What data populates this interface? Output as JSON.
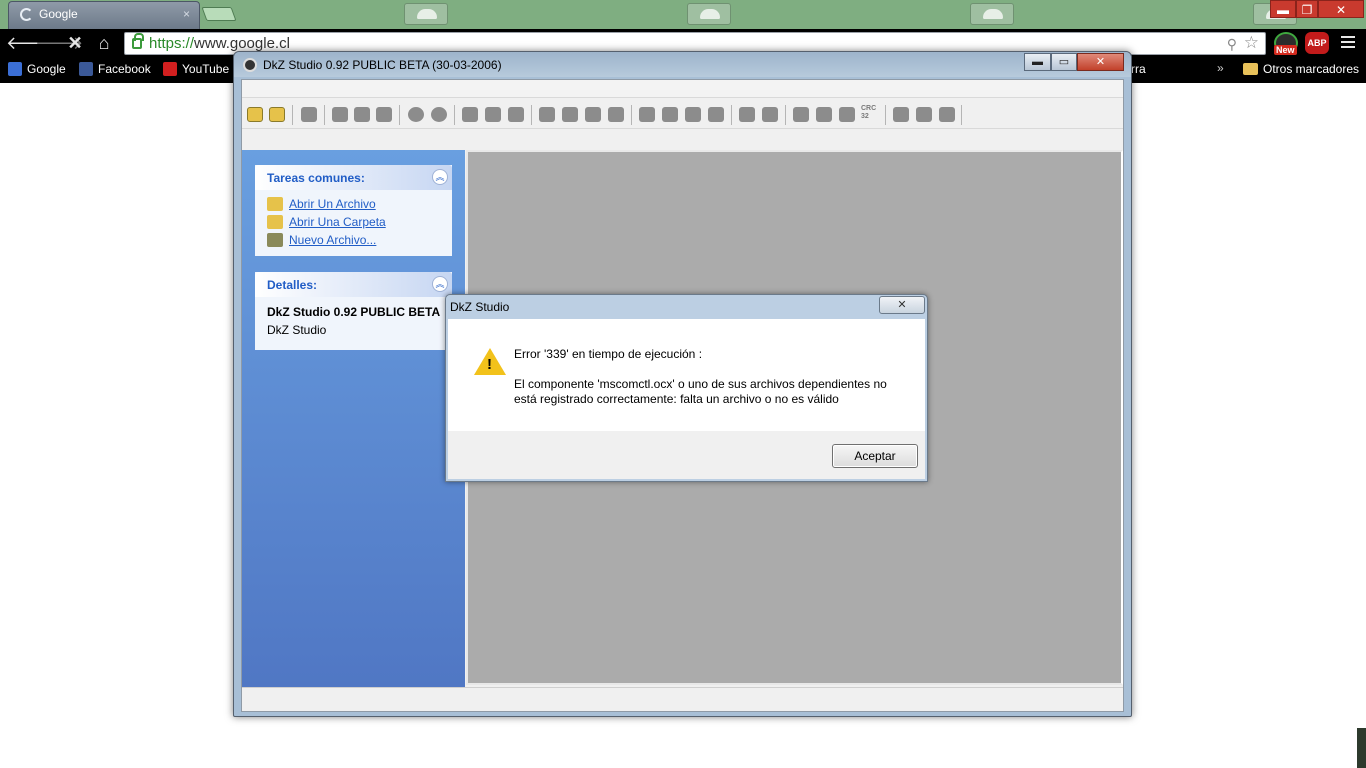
{
  "browser": {
    "tab_title": "Google",
    "tab_close": "×",
    "url_scheme": "https://",
    "url_host": "www.google.cl",
    "ext_new_badge": "New",
    "ext_abp": "ABP",
    "win_minimize": "▬",
    "win_restore": "❐",
    "win_close": "✕"
  },
  "bookmarks": {
    "items": [
      {
        "label": "Google",
        "color": "#3b6fd6"
      },
      {
        "label": "Facebook",
        "color": "#3b5998"
      },
      {
        "label": "YouTube",
        "color": "#d21f1f"
      }
    ],
    "partial_right": "rra",
    "overflow": "»",
    "other": "Otros marcadores"
  },
  "app": {
    "title": "DkZ Studio 0.92 PUBLIC BETA (30-03-2006)",
    "minimize": "▬",
    "maximize": "▭",
    "close": "✕",
    "common_tasks": {
      "title": "Tareas comunes:",
      "links": [
        "Abrir Un Archivo",
        "Abrir Una Carpeta",
        "Nuevo Archivo..."
      ]
    },
    "details": {
      "title": "Detalles:",
      "name": "DkZ Studio 0.92 PUBLIC BETA",
      "sub": "DkZ Studio"
    },
    "toolbar_text": "CRC 32"
  },
  "dialog": {
    "title": "DkZ Studio",
    "close": "✕",
    "message_title": "Error '339' en tiempo de ejecución :",
    "message_body": "El componente 'mscomctl.ocx' o uno de sus archivos dependientes no está registrado correctamente: falta un archivo o no es válido",
    "ok_button": "Aceptar"
  }
}
